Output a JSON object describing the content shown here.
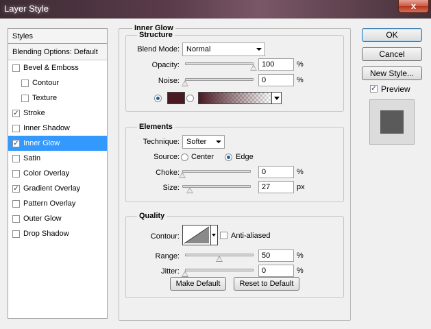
{
  "window": {
    "title": "Layer Style",
    "close_glyph": "x"
  },
  "styles_panel": {
    "header": "Styles",
    "blending_options": "Blending Options: Default",
    "items": [
      {
        "label": "Bevel & Emboss",
        "checked": false,
        "sub": false
      },
      {
        "label": "Contour",
        "checked": false,
        "sub": true
      },
      {
        "label": "Texture",
        "checked": false,
        "sub": true
      },
      {
        "label": "Stroke",
        "checked": true,
        "sub": false
      },
      {
        "label": "Inner Shadow",
        "checked": false,
        "sub": false
      },
      {
        "label": "Inner Glow",
        "checked": true,
        "sub": false,
        "selected": true
      },
      {
        "label": "Satin",
        "checked": false,
        "sub": false
      },
      {
        "label": "Color Overlay",
        "checked": false,
        "sub": false
      },
      {
        "label": "Gradient Overlay",
        "checked": true,
        "sub": false
      },
      {
        "label": "Pattern Overlay",
        "checked": false,
        "sub": false
      },
      {
        "label": "Outer Glow",
        "checked": false,
        "sub": false
      },
      {
        "label": "Drop Shadow",
        "checked": false,
        "sub": false
      }
    ]
  },
  "inner_glow": {
    "title": "Inner Glow",
    "structure": {
      "title": "Structure",
      "blend_mode_label": "Blend Mode:",
      "blend_mode_value": "Normal",
      "opacity_label": "Opacity:",
      "opacity_value": "100",
      "opacity_unit": "%",
      "opacity_fraction": 1.0,
      "noise_label": "Noise:",
      "noise_value": "0",
      "noise_unit": "%",
      "noise_fraction": 0.0,
      "glow_color": "#4a1a23",
      "mode": "color"
    },
    "elements": {
      "title": "Elements",
      "technique_label": "Technique:",
      "technique_value": "Softer",
      "source_label": "Source:",
      "source_center": "Center",
      "source_edge": "Edge",
      "source_selected": "edge",
      "choke_label": "Choke:",
      "choke_value": "0",
      "choke_unit": "%",
      "choke_fraction": 0.0,
      "size_label": "Size:",
      "size_value": "27",
      "size_unit": "px",
      "size_fraction": 0.108
    },
    "quality": {
      "title": "Quality",
      "contour_label": "Contour:",
      "anti_aliased_label": "Anti-aliased",
      "anti_aliased": false,
      "range_label": "Range:",
      "range_value": "50",
      "range_unit": "%",
      "range_fraction": 0.5,
      "jitter_label": "Jitter:",
      "jitter_value": "0",
      "jitter_unit": "%",
      "jitter_fraction": 0.0
    },
    "make_default": "Make Default",
    "reset_default": "Reset to Default"
  },
  "buttons": {
    "ok": "OK",
    "cancel": "Cancel",
    "new_style": "New Style...",
    "preview_label": "Preview",
    "preview_checked": true
  }
}
